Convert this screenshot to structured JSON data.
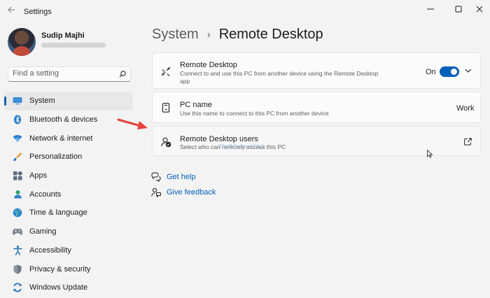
{
  "window": {
    "title": "Settings"
  },
  "profile": {
    "name": "Sudip Majhi"
  },
  "search": {
    "placeholder": "Find a setting"
  },
  "sidebar": {
    "items": [
      {
        "label": "System",
        "icon": "system-icon",
        "active": true
      },
      {
        "label": "Bluetooth & devices",
        "icon": "bluetooth-icon"
      },
      {
        "label": "Network & internet",
        "icon": "network-icon"
      },
      {
        "label": "Personalization",
        "icon": "personalization-icon"
      },
      {
        "label": "Apps",
        "icon": "apps-icon"
      },
      {
        "label": "Accounts",
        "icon": "accounts-icon"
      },
      {
        "label": "Time & language",
        "icon": "time-language-icon"
      },
      {
        "label": "Gaming",
        "icon": "gaming-icon"
      },
      {
        "label": "Accessibility",
        "icon": "accessibility-icon"
      },
      {
        "label": "Privacy & security",
        "icon": "privacy-icon"
      },
      {
        "label": "Windows Update",
        "icon": "windows-update-icon"
      }
    ]
  },
  "breadcrumb": {
    "parent": "System",
    "separator": "›",
    "current": "Remote Desktop"
  },
  "cards": {
    "remote_desktop": {
      "title": "Remote Desktop",
      "description": "Connect to and use this PC from another device using the Remote Desktop app",
      "toggle_label": "On",
      "toggle_on": true
    },
    "pc_name": {
      "title": "PC name",
      "description": "Use this name to connect to this PC from another device",
      "value": "Work"
    },
    "users": {
      "title": "Remote Desktop users",
      "description": "Select who can remotely access this PC",
      "watermark": "TheWindowsClub"
    }
  },
  "links": {
    "get_help": "Get help",
    "give_feedback": "Give feedback"
  },
  "colors": {
    "accent": "#005fb8",
    "annotation_arrow": "#e8413c",
    "background": "#f3f3f3"
  }
}
